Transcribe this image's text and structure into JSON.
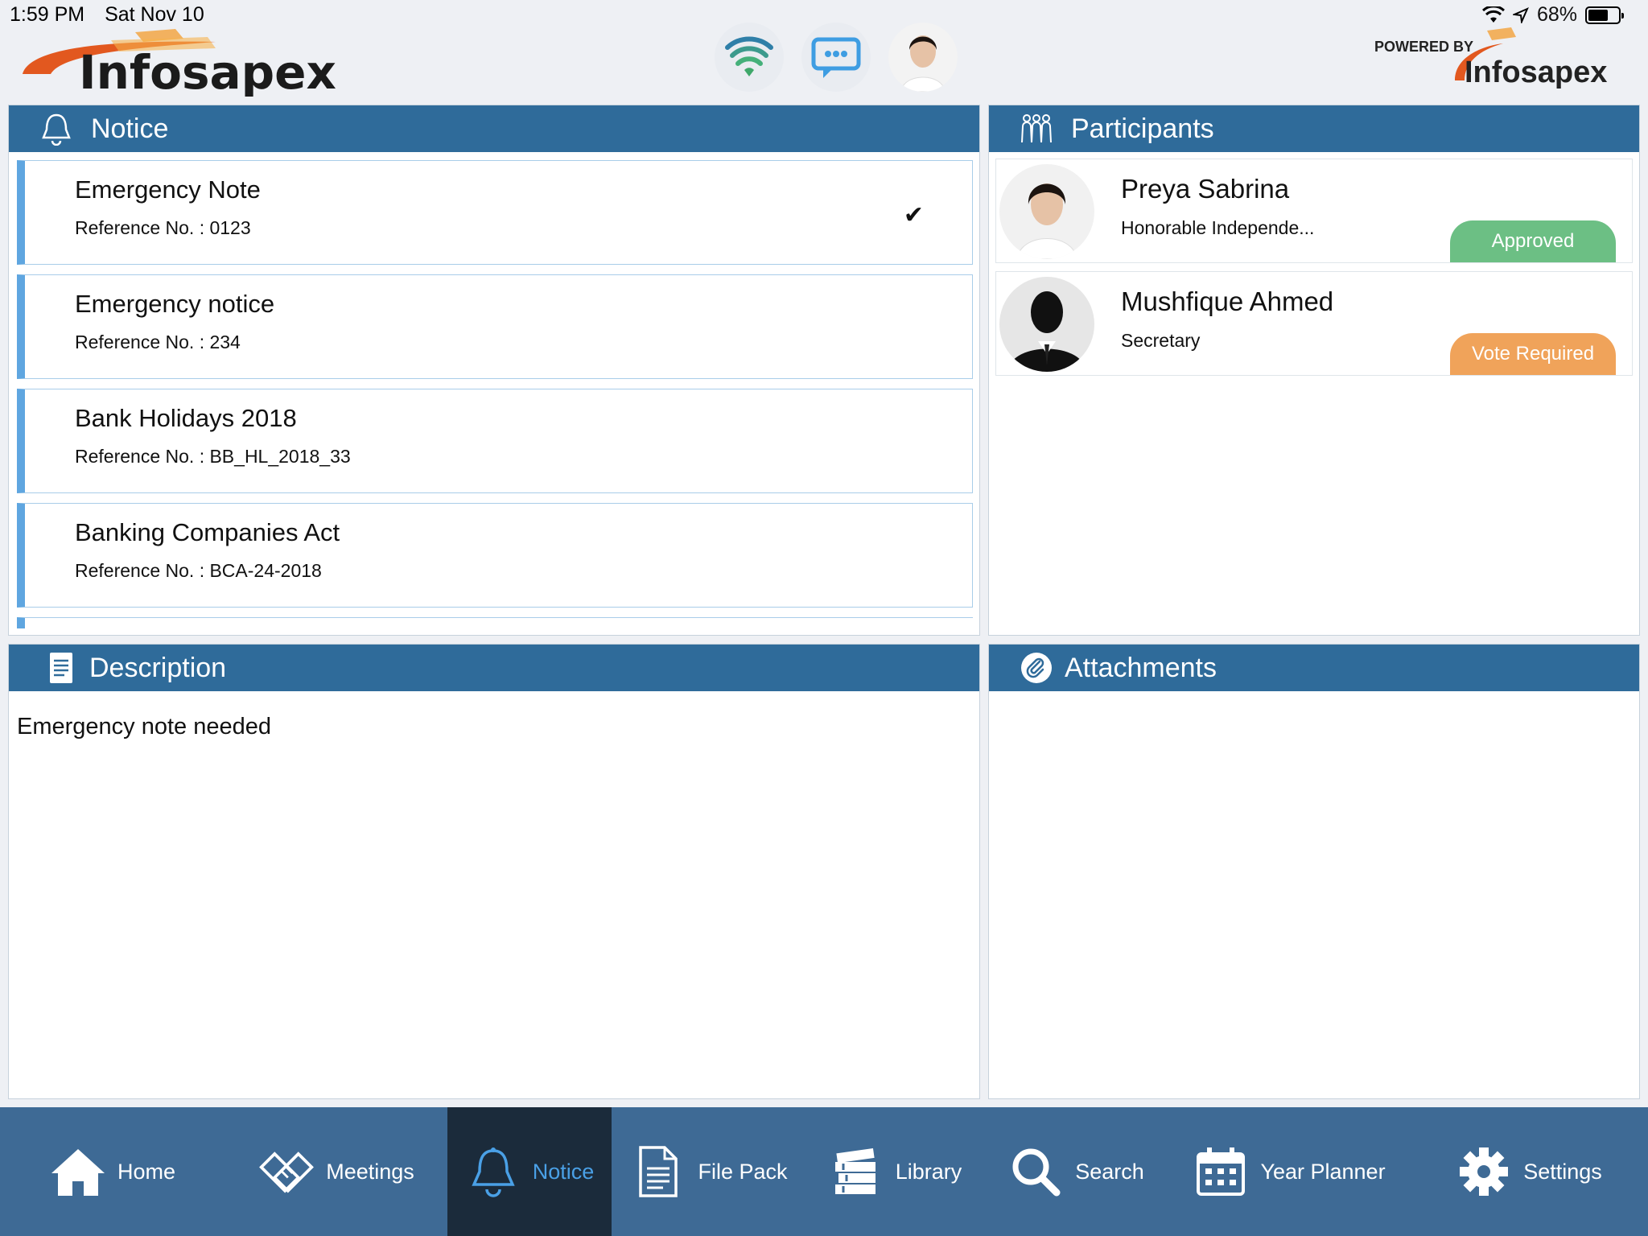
{
  "status_bar": {
    "time": "1:59 PM",
    "date": "Sat Nov 10",
    "battery": "68%",
    "battery_level": 0.68
  },
  "header": {
    "logo_text": "Infosapex",
    "powered_by_label": "POWERED BY",
    "powered_by_brand": "Infosapex",
    "icons": [
      "wifi-icon",
      "chat-icon",
      "profile-avatar"
    ]
  },
  "notice": {
    "title": "Notice",
    "items": [
      {
        "title": "Emergency Note",
        "reference": "Reference No. : 0123",
        "selected": true
      },
      {
        "title": "Emergency notice",
        "reference": "Reference No. : 234",
        "selected": false
      },
      {
        "title": "Bank Holidays 2018",
        "reference": "Reference No. :  BB_HL_2018_33",
        "selected": false
      },
      {
        "title": "Banking Companies Act",
        "reference": "Reference No. : BCA-24-2018",
        "selected": false
      }
    ]
  },
  "participants": {
    "title": "Participants",
    "items": [
      {
        "name": "Preya Sabrina",
        "role": "Honorable Independe...",
        "status": "Approved",
        "status_color": "#6cbf84"
      },
      {
        "name": "Mushfique Ahmed",
        "role": "Secretary",
        "status": "Vote Required",
        "status_color": "#f0a35a"
      }
    ]
  },
  "description": {
    "title": "Description",
    "text": "Emergency note needed"
  },
  "attachments": {
    "title": "Attachments"
  },
  "tabbar": {
    "tabs": [
      {
        "label": "Home",
        "icon": "home-icon"
      },
      {
        "label": "Meetings",
        "icon": "handshake-icon"
      },
      {
        "label": "Notice",
        "icon": "bell-icon",
        "active": true
      },
      {
        "label": "File Pack",
        "icon": "document-icon"
      },
      {
        "label": "Library",
        "icon": "books-icon"
      },
      {
        "label": "Search",
        "icon": "search-icon"
      },
      {
        "label": "Year Planner",
        "icon": "calendar-icon"
      },
      {
        "label": "Settings",
        "icon": "gear-icon"
      }
    ]
  },
  "colors": {
    "header_blue": "#2f6b9a",
    "tabbar_blue": "#3e6a95",
    "active_tab_bg": "#1b2b3b",
    "active_tab_text": "#4aa0e6",
    "notice_accent": "#5fa6e0"
  }
}
